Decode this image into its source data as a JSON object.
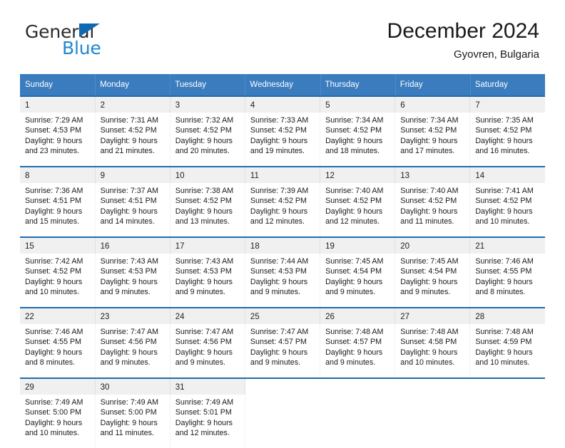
{
  "brand": {
    "line1": "General",
    "line2": "Blue",
    "triangle_color": "#1168b3",
    "blue_text_color": "#1e88d4"
  },
  "header": {
    "title": "December 2024",
    "subtitle": "Gyovren, Bulgaria"
  },
  "theme": {
    "header_row_bg": "#3a7cbe",
    "daynum_bg": "#f0f0f0",
    "week_separator": "#1f6cb0",
    "text": "#1a1a1a"
  },
  "weekdays": [
    "Sunday",
    "Monday",
    "Tuesday",
    "Wednesday",
    "Thursday",
    "Friday",
    "Saturday"
  ],
  "weeks": [
    {
      "days": [
        {
          "num": "1",
          "sunrise": "Sunrise: 7:29 AM",
          "sunset": "Sunset: 4:53 PM",
          "daylight1": "Daylight: 9 hours",
          "daylight2": "and 23 minutes."
        },
        {
          "num": "2",
          "sunrise": "Sunrise: 7:31 AM",
          "sunset": "Sunset: 4:52 PM",
          "daylight1": "Daylight: 9 hours",
          "daylight2": "and 21 minutes."
        },
        {
          "num": "3",
          "sunrise": "Sunrise: 7:32 AM",
          "sunset": "Sunset: 4:52 PM",
          "daylight1": "Daylight: 9 hours",
          "daylight2": "and 20 minutes."
        },
        {
          "num": "4",
          "sunrise": "Sunrise: 7:33 AM",
          "sunset": "Sunset: 4:52 PM",
          "daylight1": "Daylight: 9 hours",
          "daylight2": "and 19 minutes."
        },
        {
          "num": "5",
          "sunrise": "Sunrise: 7:34 AM",
          "sunset": "Sunset: 4:52 PM",
          "daylight1": "Daylight: 9 hours",
          "daylight2": "and 18 minutes."
        },
        {
          "num": "6",
          "sunrise": "Sunrise: 7:34 AM",
          "sunset": "Sunset: 4:52 PM",
          "daylight1": "Daylight: 9 hours",
          "daylight2": "and 17 minutes."
        },
        {
          "num": "7",
          "sunrise": "Sunrise: 7:35 AM",
          "sunset": "Sunset: 4:52 PM",
          "daylight1": "Daylight: 9 hours",
          "daylight2": "and 16 minutes."
        }
      ]
    },
    {
      "days": [
        {
          "num": "8",
          "sunrise": "Sunrise: 7:36 AM",
          "sunset": "Sunset: 4:51 PM",
          "daylight1": "Daylight: 9 hours",
          "daylight2": "and 15 minutes."
        },
        {
          "num": "9",
          "sunrise": "Sunrise: 7:37 AM",
          "sunset": "Sunset: 4:51 PM",
          "daylight1": "Daylight: 9 hours",
          "daylight2": "and 14 minutes."
        },
        {
          "num": "10",
          "sunrise": "Sunrise: 7:38 AM",
          "sunset": "Sunset: 4:52 PM",
          "daylight1": "Daylight: 9 hours",
          "daylight2": "and 13 minutes."
        },
        {
          "num": "11",
          "sunrise": "Sunrise: 7:39 AM",
          "sunset": "Sunset: 4:52 PM",
          "daylight1": "Daylight: 9 hours",
          "daylight2": "and 12 minutes."
        },
        {
          "num": "12",
          "sunrise": "Sunrise: 7:40 AM",
          "sunset": "Sunset: 4:52 PM",
          "daylight1": "Daylight: 9 hours",
          "daylight2": "and 12 minutes."
        },
        {
          "num": "13",
          "sunrise": "Sunrise: 7:40 AM",
          "sunset": "Sunset: 4:52 PM",
          "daylight1": "Daylight: 9 hours",
          "daylight2": "and 11 minutes."
        },
        {
          "num": "14",
          "sunrise": "Sunrise: 7:41 AM",
          "sunset": "Sunset: 4:52 PM",
          "daylight1": "Daylight: 9 hours",
          "daylight2": "and 10 minutes."
        }
      ]
    },
    {
      "days": [
        {
          "num": "15",
          "sunrise": "Sunrise: 7:42 AM",
          "sunset": "Sunset: 4:52 PM",
          "daylight1": "Daylight: 9 hours",
          "daylight2": "and 10 minutes."
        },
        {
          "num": "16",
          "sunrise": "Sunrise: 7:43 AM",
          "sunset": "Sunset: 4:53 PM",
          "daylight1": "Daylight: 9 hours",
          "daylight2": "and 9 minutes."
        },
        {
          "num": "17",
          "sunrise": "Sunrise: 7:43 AM",
          "sunset": "Sunset: 4:53 PM",
          "daylight1": "Daylight: 9 hours",
          "daylight2": "and 9 minutes."
        },
        {
          "num": "18",
          "sunrise": "Sunrise: 7:44 AM",
          "sunset": "Sunset: 4:53 PM",
          "daylight1": "Daylight: 9 hours",
          "daylight2": "and 9 minutes."
        },
        {
          "num": "19",
          "sunrise": "Sunrise: 7:45 AM",
          "sunset": "Sunset: 4:54 PM",
          "daylight1": "Daylight: 9 hours",
          "daylight2": "and 9 minutes."
        },
        {
          "num": "20",
          "sunrise": "Sunrise: 7:45 AM",
          "sunset": "Sunset: 4:54 PM",
          "daylight1": "Daylight: 9 hours",
          "daylight2": "and 9 minutes."
        },
        {
          "num": "21",
          "sunrise": "Sunrise: 7:46 AM",
          "sunset": "Sunset: 4:55 PM",
          "daylight1": "Daylight: 9 hours",
          "daylight2": "and 8 minutes."
        }
      ]
    },
    {
      "days": [
        {
          "num": "22",
          "sunrise": "Sunrise: 7:46 AM",
          "sunset": "Sunset: 4:55 PM",
          "daylight1": "Daylight: 9 hours",
          "daylight2": "and 8 minutes."
        },
        {
          "num": "23",
          "sunrise": "Sunrise: 7:47 AM",
          "sunset": "Sunset: 4:56 PM",
          "daylight1": "Daylight: 9 hours",
          "daylight2": "and 9 minutes."
        },
        {
          "num": "24",
          "sunrise": "Sunrise: 7:47 AM",
          "sunset": "Sunset: 4:56 PM",
          "daylight1": "Daylight: 9 hours",
          "daylight2": "and 9 minutes."
        },
        {
          "num": "25",
          "sunrise": "Sunrise: 7:47 AM",
          "sunset": "Sunset: 4:57 PM",
          "daylight1": "Daylight: 9 hours",
          "daylight2": "and 9 minutes."
        },
        {
          "num": "26",
          "sunrise": "Sunrise: 7:48 AM",
          "sunset": "Sunset: 4:57 PM",
          "daylight1": "Daylight: 9 hours",
          "daylight2": "and 9 minutes."
        },
        {
          "num": "27",
          "sunrise": "Sunrise: 7:48 AM",
          "sunset": "Sunset: 4:58 PM",
          "daylight1": "Daylight: 9 hours",
          "daylight2": "and 10 minutes."
        },
        {
          "num": "28",
          "sunrise": "Sunrise: 7:48 AM",
          "sunset": "Sunset: 4:59 PM",
          "daylight1": "Daylight: 9 hours",
          "daylight2": "and 10 minutes."
        }
      ]
    },
    {
      "days": [
        {
          "num": "29",
          "sunrise": "Sunrise: 7:49 AM",
          "sunset": "Sunset: 5:00 PM",
          "daylight1": "Daylight: 9 hours",
          "daylight2": "and 10 minutes."
        },
        {
          "num": "30",
          "sunrise": "Sunrise: 7:49 AM",
          "sunset": "Sunset: 5:00 PM",
          "daylight1": "Daylight: 9 hours",
          "daylight2": "and 11 minutes."
        },
        {
          "num": "31",
          "sunrise": "Sunrise: 7:49 AM",
          "sunset": "Sunset: 5:01 PM",
          "daylight1": "Daylight: 9 hours",
          "daylight2": "and 12 minutes."
        },
        {
          "num": "",
          "sunrise": "",
          "sunset": "",
          "daylight1": "",
          "daylight2": "",
          "empty": true
        },
        {
          "num": "",
          "sunrise": "",
          "sunset": "",
          "daylight1": "",
          "daylight2": "",
          "empty": true
        },
        {
          "num": "",
          "sunrise": "",
          "sunset": "",
          "daylight1": "",
          "daylight2": "",
          "empty": true
        },
        {
          "num": "",
          "sunrise": "",
          "sunset": "",
          "daylight1": "",
          "daylight2": "",
          "empty": true
        }
      ]
    }
  ]
}
